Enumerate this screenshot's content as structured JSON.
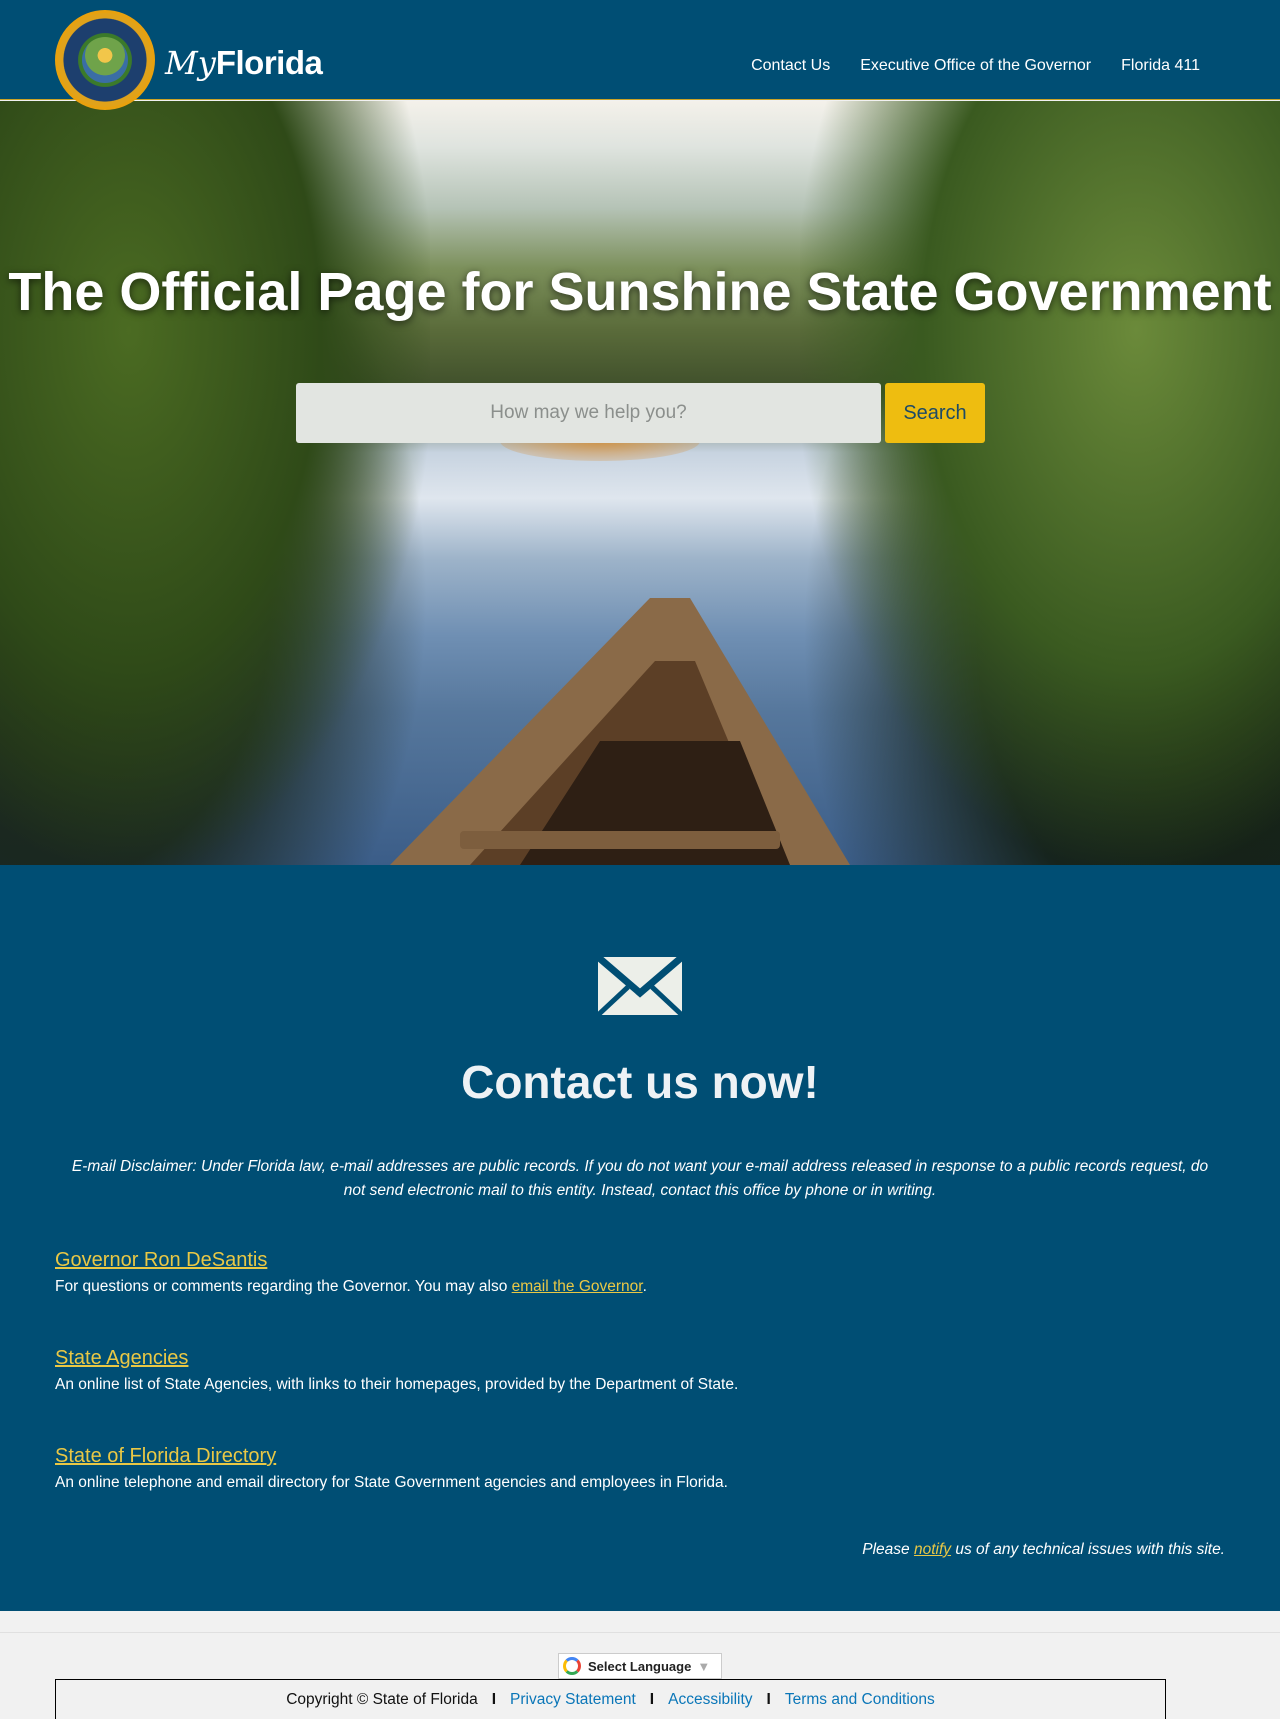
{
  "header": {
    "brand_my": "My",
    "brand_florida": "Florida",
    "nav": [
      {
        "label": "Contact Us"
      },
      {
        "label": "Executive Office of the Governor"
      },
      {
        "label": "Florida 411"
      }
    ]
  },
  "hero": {
    "title": "The Official Page for Sunshine State Government",
    "search_placeholder": "How may we help you?",
    "search_button": "Search"
  },
  "contact": {
    "icon": "envelope-icon",
    "title": "Contact us now!",
    "disclaimer": "E-mail Disclaimer: Under Florida law, e-mail addresses are public records. If you do not want your e-mail address released in response to a public records request, do not send electronic mail to this entity. Instead, contact this office by phone or in writing.",
    "entries": [
      {
        "heading": "Governor Ron DeSantis",
        "text": "For questions or comments regarding the Governor. You may also ",
        "link": "email the Governor",
        "text_after": "."
      },
      {
        "heading": "State Agencies",
        "text": "An online list of State Agencies, with links to their homepages, provided by the Department of State."
      },
      {
        "heading": "State of Florida Directory",
        "text": "An online telephone and email directory for State Government agencies and employees in Florida."
      }
    ],
    "notify_before": "Please ",
    "notify_link": "notify",
    "notify_after": " us of any technical issues with this site."
  },
  "footer": {
    "language_label": "Select Language",
    "language_arrow": "▼",
    "copyright": "Copyright © State of Florida",
    "separator": "I",
    "links": [
      "Privacy Statement",
      "Accessibility",
      "Terms and Conditions"
    ]
  },
  "colors": {
    "primary": "#004e74",
    "accent": "#eebd10",
    "link_yellow": "#e9c845",
    "footer_link": "#0a76b8"
  }
}
